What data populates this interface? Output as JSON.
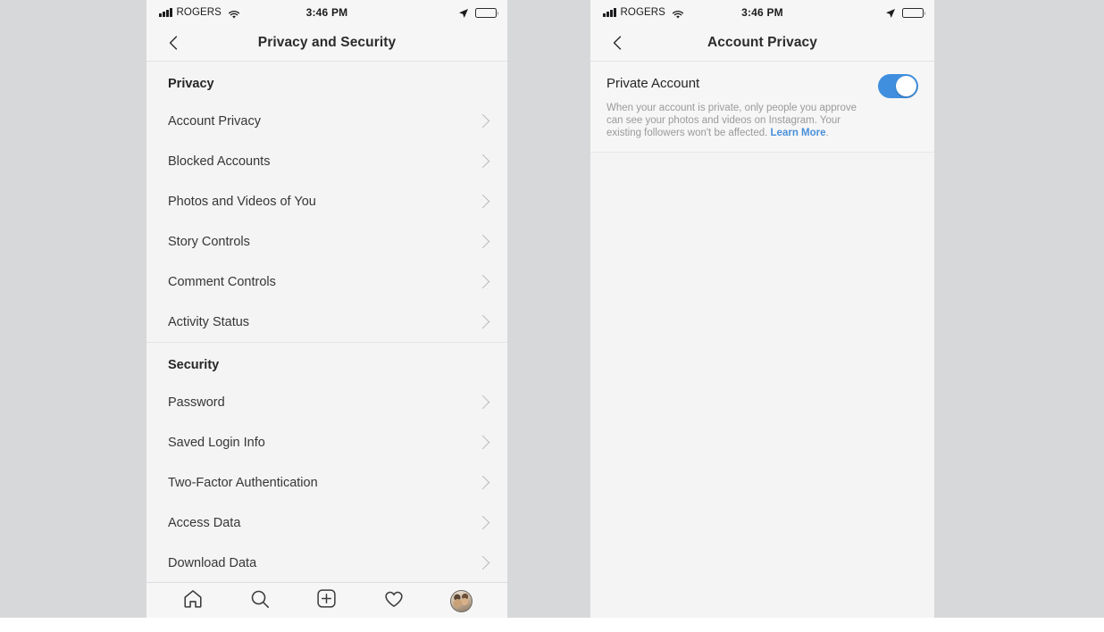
{
  "status_bar": {
    "carrier": "ROGERS",
    "time": "3:46 PM",
    "signal_icon": "cellular-signal-icon",
    "wifi_icon": "wifi-icon",
    "location_icon": "location-arrow-icon",
    "battery_icon": "battery-icon"
  },
  "colors": {
    "toggle_on": "#3f8fde",
    "link": "#4a90d9",
    "page_background": "#d7d8da",
    "screen_background": "#f4f4f5"
  },
  "left_screen": {
    "nav": {
      "back_icon": "chevron-left-icon",
      "title": "Privacy and Security"
    },
    "sections": [
      {
        "header": "Privacy",
        "rows": [
          {
            "label": "Account Privacy",
            "chevron": "chevron-right-icon"
          },
          {
            "label": "Blocked Accounts",
            "chevron": "chevron-right-icon"
          },
          {
            "label": "Photos and Videos of You",
            "chevron": "chevron-right-icon"
          },
          {
            "label": "Story Controls",
            "chevron": "chevron-right-icon"
          },
          {
            "label": "Comment Controls",
            "chevron": "chevron-right-icon"
          },
          {
            "label": "Activity Status",
            "chevron": "chevron-right-icon"
          }
        ]
      },
      {
        "header": "Security",
        "rows": [
          {
            "label": "Password",
            "chevron": "chevron-right-icon"
          },
          {
            "label": "Saved Login Info",
            "chevron": "chevron-right-icon"
          },
          {
            "label": "Two-Factor Authentication",
            "chevron": "chevron-right-icon"
          },
          {
            "label": "Access Data",
            "chevron": "chevron-right-icon"
          },
          {
            "label": "Download Data",
            "chevron": "chevron-right-icon"
          }
        ]
      }
    ],
    "tab_bar": [
      {
        "name": "home-icon"
      },
      {
        "name": "search-icon"
      },
      {
        "name": "add-post-icon"
      },
      {
        "name": "heart-icon"
      },
      {
        "name": "profile-avatar"
      }
    ]
  },
  "right_screen": {
    "nav": {
      "back_icon": "chevron-left-icon",
      "title": "Account Privacy"
    },
    "private_account": {
      "title": "Private Account",
      "toggle_state": "on",
      "description": "When your account is private, only people you approve can see your photos and videos on Instagram. Your existing followers won't be affected. ",
      "learn_more": "Learn More",
      "description_end": "."
    }
  }
}
